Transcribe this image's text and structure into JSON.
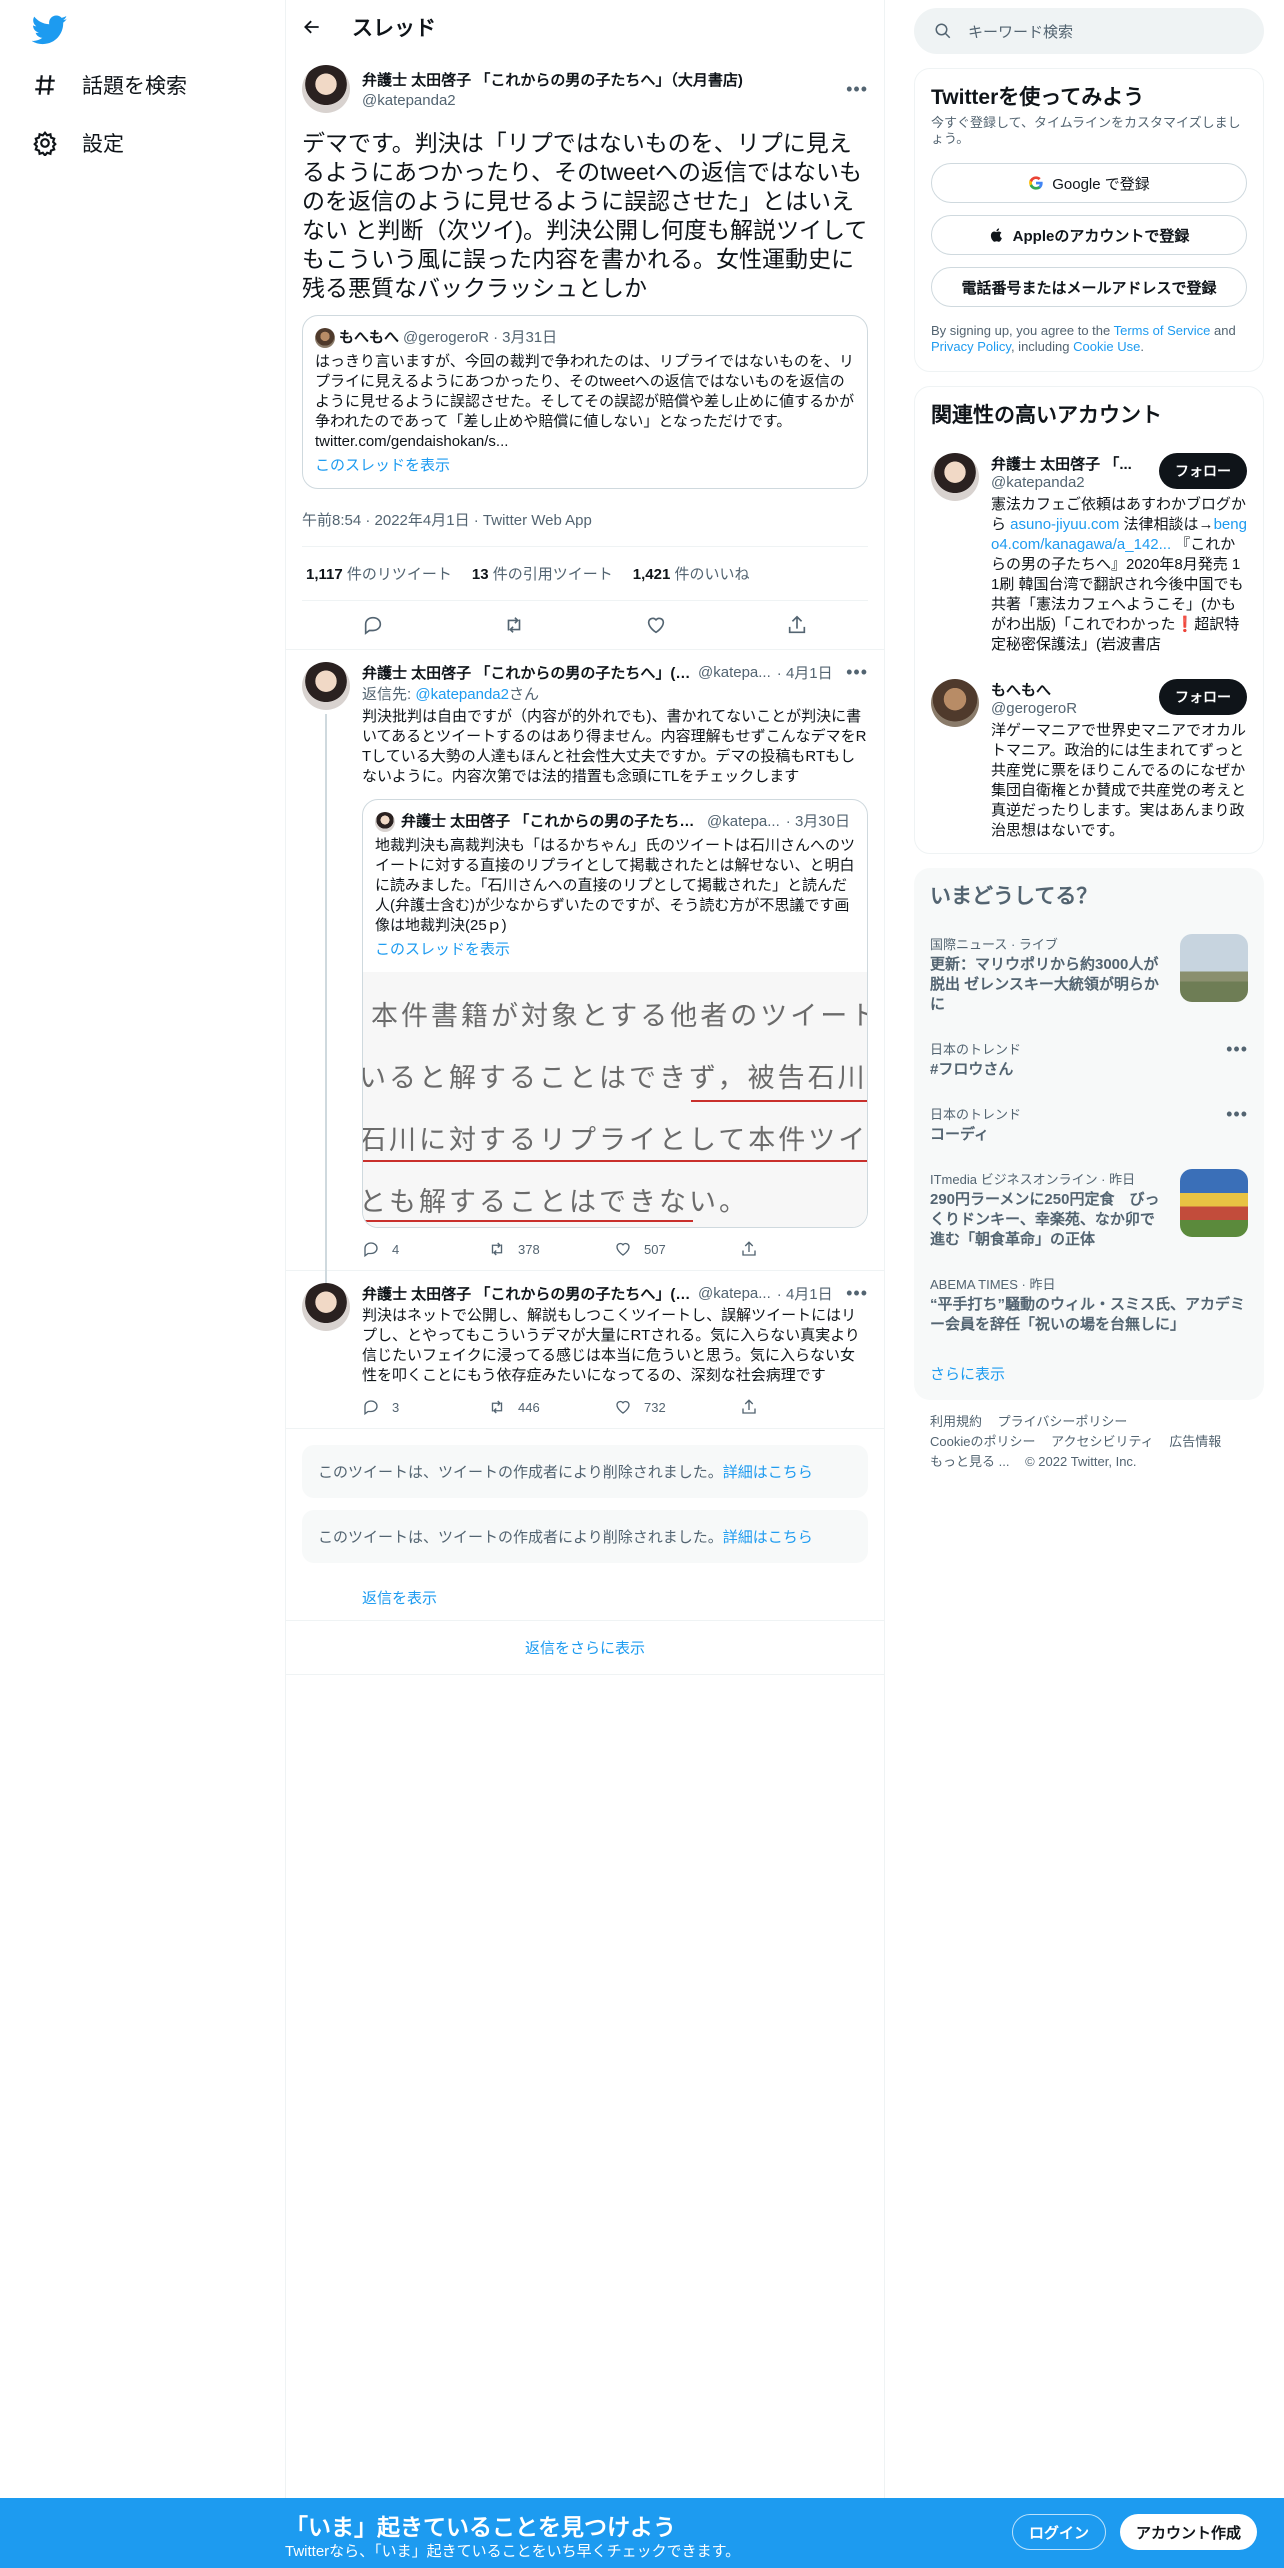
{
  "nav": {
    "explore_label": "話題を検索",
    "settings_label": "設定"
  },
  "thread": {
    "title": "スレッド",
    "main_tweet": {
      "author_name": "弁護士 太田啓子 「これからの男の子たちへ」（大月書店)",
      "author_handle": "@katepanda2",
      "text": "デマです。判決は「リプではないものを、リプに見えるようにあつかったり、そのtweetへの返信ではないものを返信のように見せるように誤認させた」とはいえない と判断（次ツイ)。判決公開し何度も解説ツイしてもこういう風に誤った内容を書かれる。女性運動史に残る悪質なバックラッシュとしか",
      "quote": {
        "author_name": "もへもへ",
        "author_handle": "@gerogeroR",
        "date": "3月31日",
        "text": "はっきり言いますが、今回の裁判で争われたのは、リプライではないものを、リプライに見えるようにあつかったり、そのtweetへの返信ではないものを返信のように見せるように誤認させた。そしてその誤認が賠償や差し止めに値するかが争われたのであって「差し止めや賠償に値しない」となっただけです。",
        "link": "twitter.com/gendaishokan/s...",
        "show_thread": "このスレッドを表示"
      },
      "meta": "午前8:54 · 2022年4月1日 · Twitter Web App",
      "retweets_count": "1,117",
      "retweets_label": "件のリツイート",
      "quotes_count": "13",
      "quotes_label": "件の引用ツイート",
      "likes_count": "1,421",
      "likes_label": "件のいいね"
    },
    "replies": [
      {
        "author_name": "弁護士 太田啓子 「これからの男の子たちへ」(大月書店)",
        "author_handle": "@katepa...",
        "date": "· 4月1日",
        "reply_to_prefix": "返信先: ",
        "reply_to_handle": "@katepanda2",
        "reply_to_suffix": "さん",
        "text": "判決批判は自由ですが（内容が的外れでも)、書かれてないことが判決に書いてあるとツイートするのはあり得ません。内容理解もせずこんなデマをRTしている大勢の人達もほんと社会性大丈夫ですか。デマの投稿もRTもしないように。内容次第では法的措置も念頭にTLをチェックします",
        "quoted": {
          "author_name": "弁護士 太田啓子 「これからの男の子たちへ」(大月書店)",
          "author_handle": "@katepa...",
          "date": "· 3月30日",
          "text": "地裁判決も高裁判決も「はるかちゃん」氏のツイートは石川さんへのツイートに対する直接のリプライとして掲載されたとは解せない、と明白に読みました。「石川さんへの直接のリプとして掲載された」と読んだ人(弁護士含む)が少なからずいたのですが、そう読む方が不思議です画像は地裁判決(25ｐ)",
          "show_thread": "このスレッドを表示",
          "image_lines": [
            "本件書籍が対象とする他者のツイートが被",
            "いると解することはできず，被告石川が，本",
            "石川に対するリプライとして本件ツイートが",
            "とも解することはできない。"
          ]
        },
        "reply_count": "4",
        "retweet_count": "378",
        "like_count": "507"
      },
      {
        "author_name": "弁護士 太田啓子 「これからの男の子たちへ」(大月書店)",
        "author_handle": "@katepa...",
        "date": "· 4月1日",
        "text": "判決はネットで公開し、解説もしつこくツイートし、誤解ツイートにはリプし、とやってもこういうデマが大量にRTされる。気に入らない真実より信じたいフェイクに浸ってる感じは本当に危ういと思う。気に入らない女性を叩くことにもう依存症みたいになってるの、深刻な社会病理です",
        "reply_count": "3",
        "retweet_count": "446",
        "like_count": "732"
      }
    ],
    "deleted_text": "このツイートは、ツイートの作成者により削除されました。",
    "deleted_link": "詳細はこちら",
    "show_replies": "返信を表示",
    "show_more_replies": "返信をさらに表示"
  },
  "search": {
    "placeholder": "キーワード検索"
  },
  "signup": {
    "title": "Twitterを使ってみよう",
    "subtitle": "今すぐ登録して、タイムラインをカスタマイズしましょう。",
    "google": "Google で登録",
    "apple": "Appleのアカウントで登録",
    "phone": "電話番号またはメールアドレスで登録",
    "terms_prefix": "By signing up, you agree to the ",
    "terms_link": "Terms of Service",
    "terms_and": " and ",
    "privacy_link": "Privacy Policy",
    "terms_including": ", including ",
    "cookie_link": "Cookie Use",
    "terms_end": "."
  },
  "related": {
    "title": "関連性の高いアカウント",
    "follow_label": "フォロー",
    "accounts": [
      {
        "name": "弁護士 太田啓子 「...",
        "handle": "@katepanda2",
        "bio_1": "憲法カフェご依頼はあすわかブログから ",
        "bio_link_1": "asuno-jiyuu.com",
        "bio_2": " 法律相談は→",
        "bio_link_2": "bengo4.com/kanagawa/a_142...",
        "bio_3": " 『これからの男の子たちへ』2020年8月発売 11刷 韓国台湾で翻訳され今後中国でも 共著「憲法カフェへようこそ」(かもがわ出版)「これでわかった❗超訳特定秘密保護法」(岩波書店"
      },
      {
        "name": "もへもへ",
        "handle": "@gerogeroR",
        "bio_1": "洋ゲーマニアで世界史マニアでオカルトマニア。政治的には生まれてずっと共産党に票をほりこんでるのになぜか集団自衛権とか賛成で共産党の考えと真逆だったりします。実はあんまり政治思想はないです。"
      }
    ]
  },
  "trends": {
    "title": "いまどうしてる？",
    "items": [
      {
        "context": "国際ニュース · ライブ",
        "title": "更新：マリウポリから約3000人が脱出 ゼレンスキー大統領が明らかに",
        "has_thumb": true
      },
      {
        "context": "日本のトレンド",
        "title": "#フロウさん",
        "has_thumb": false
      },
      {
        "context": "日本のトレンド",
        "title": "コーディ",
        "has_thumb": false
      },
      {
        "context": "ITmedia ビジネスオンライン · 昨日",
        "title": "290円ラーメンに250円定食　びっくりドンキー、幸楽苑、なか卯で進む「朝食革命」の正体",
        "has_thumb": true
      },
      {
        "context": "ABEMA TIMES · 昨日",
        "title": "“平手打ち”騒動のウィル・スミス氏、アカデミー会員を辞任「祝いの場を台無しに」",
        "has_thumb": false
      }
    ],
    "show_more": "さらに表示"
  },
  "footer": {
    "links": [
      "利用規約",
      "プライバシーポリシー",
      "Cookieのポリシー",
      "アクセシビリティ",
      "広告情報",
      "もっと見る ..."
    ],
    "copyright": "© 2022 Twitter, Inc."
  },
  "bottom_bar": {
    "headline": "「いま」起きていることを見つけよう",
    "subline": "Twitterなら、「いま」起きていることをいち早くチェックできます。",
    "login": "ログイン",
    "signup": "アカウント作成"
  },
  "colors": {
    "brand": "#1d9bf0",
    "text": "#0f1419",
    "secondary": "#536471"
  }
}
